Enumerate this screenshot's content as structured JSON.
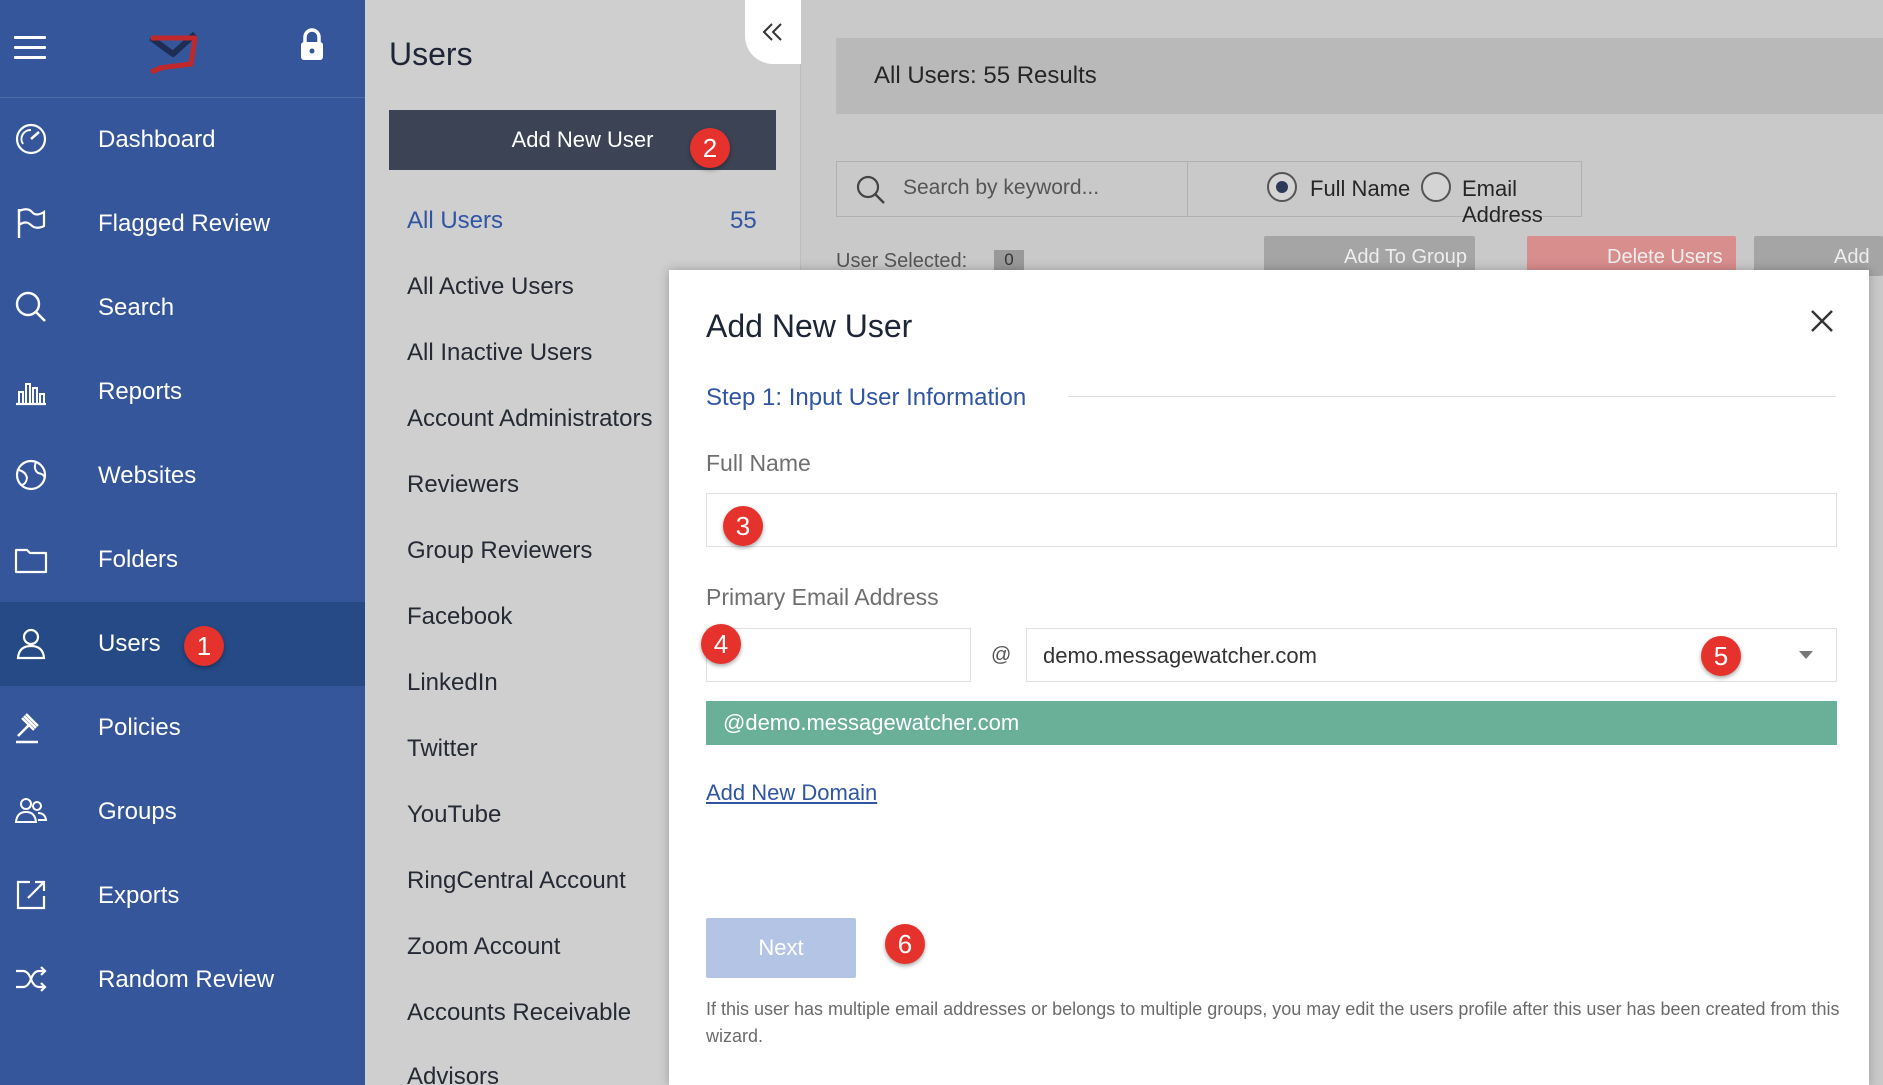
{
  "sidebar": {
    "items": [
      {
        "label": "Dashboard",
        "icon": "dashboard-icon"
      },
      {
        "label": "Flagged Review",
        "icon": "flag-icon"
      },
      {
        "label": "Search",
        "icon": "search-icon"
      },
      {
        "label": "Reports",
        "icon": "bar-chart-icon"
      },
      {
        "label": "Websites",
        "icon": "globe-icon"
      },
      {
        "label": "Folders",
        "icon": "folder-icon"
      },
      {
        "label": "Users",
        "icon": "user-icon"
      },
      {
        "label": "Policies",
        "icon": "gavel-icon"
      },
      {
        "label": "Groups",
        "icon": "groups-icon"
      },
      {
        "label": "Exports",
        "icon": "export-icon"
      },
      {
        "label": "Random Review",
        "icon": "shuffle-icon"
      }
    ],
    "active": "Users"
  },
  "users_panel": {
    "title": "Users",
    "add_button": "Add New User",
    "filters": [
      {
        "label": "All Users",
        "count": "55"
      },
      {
        "label": "All Active Users"
      },
      {
        "label": "All Inactive Users"
      },
      {
        "label": "Account Administrators"
      },
      {
        "label": "Reviewers"
      },
      {
        "label": "Group Reviewers"
      },
      {
        "label": "Facebook"
      },
      {
        "label": "LinkedIn"
      },
      {
        "label": "Twitter"
      },
      {
        "label": "YouTube"
      },
      {
        "label": "RingCentral Account"
      },
      {
        "label": "Zoom Account"
      },
      {
        "label": "Accounts Receivable"
      },
      {
        "label": "Advisors"
      }
    ]
  },
  "main": {
    "results": "All Users: 55 Results",
    "search_placeholder": "Search by keyword...",
    "radio_full_name": "Full Name",
    "radio_email": "Email Address",
    "user_selected_label": "User Selected:",
    "user_selected_count": "0",
    "add_to_group": "Add To Group",
    "delete_users": "Delete Users",
    "add_partial": "Add"
  },
  "modal": {
    "title": "Add New User",
    "step": "Step 1: Input User Information",
    "full_name_label": "Full Name",
    "full_name_value": "",
    "email_label": "Primary Email Address",
    "email_value": "",
    "at": "@",
    "domain_selected": "demo.messagewatcher.com",
    "domain_suggestion": "@demo.messagewatcher.com",
    "add_domain": "Add New Domain",
    "next": "Next",
    "help": "If this user has multiple email addresses or belongs to multiple groups, you may edit the users profile after this user has been created from this wizard."
  },
  "annotations": [
    "1",
    "2",
    "3",
    "4",
    "5",
    "6"
  ],
  "colors": {
    "sidebar": "#35569a",
    "sidebar_active": "#264a86",
    "accent": "#2f55a3",
    "badge": "#e5322d",
    "suggestion": "#6aaf97"
  }
}
